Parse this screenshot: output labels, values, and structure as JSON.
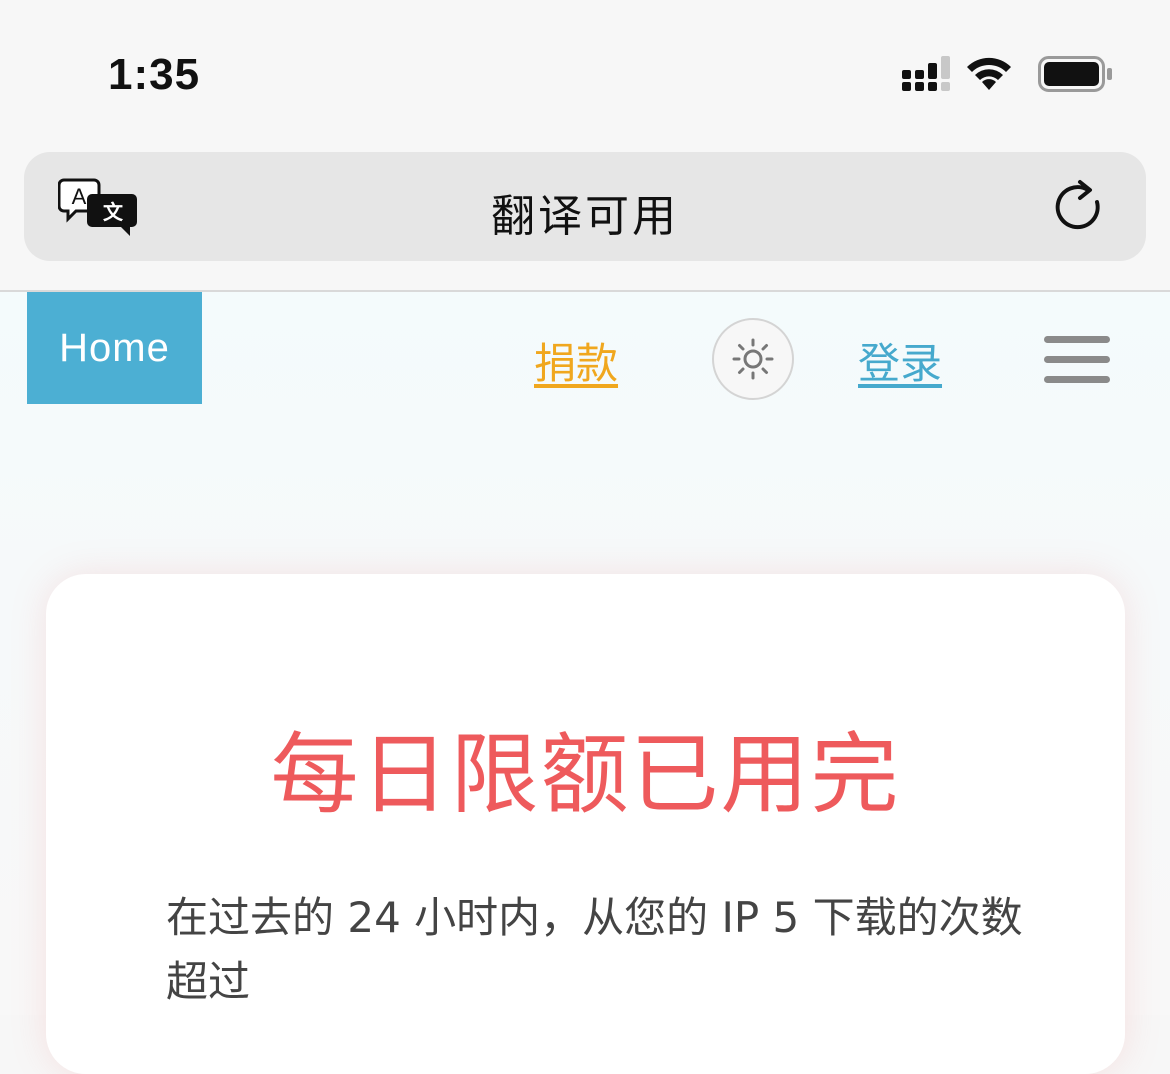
{
  "status_bar": {
    "time": "1:35",
    "icons": [
      "cellular-signal-icon",
      "wifi-icon",
      "battery-icon"
    ]
  },
  "address_bar": {
    "title": "翻译可用",
    "left_icon": "translate-icon",
    "right_icon": "reload-icon"
  },
  "nav": {
    "home_label": "Home",
    "donate_label": "捐款",
    "theme_icon": "sun-icon",
    "login_label": "登录",
    "menu_icon": "hamburger-menu-icon"
  },
  "card": {
    "title": "每日限额已用完",
    "message": "在过去的 24 小时内，从您的 IP 5 下载的次数超过"
  },
  "colors": {
    "home_bg": "#4cafd3",
    "donate": "#f0a71e",
    "login": "#46a9cd",
    "title": "#ee5a5c"
  }
}
